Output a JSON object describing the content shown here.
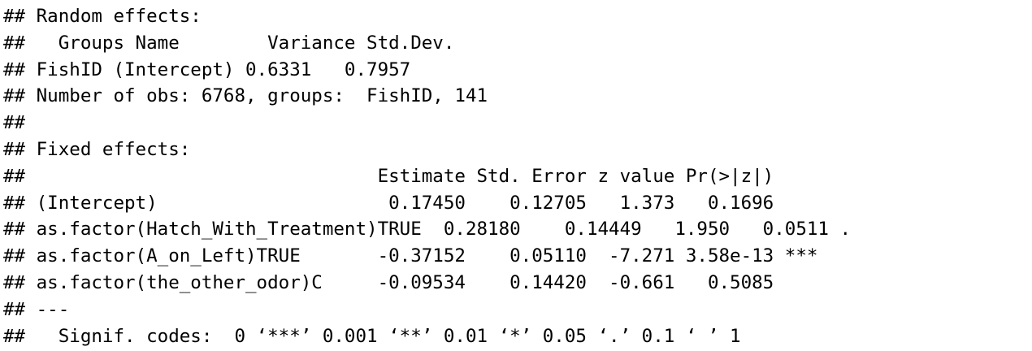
{
  "lines": [
    "## Random effects:",
    "##   Groups Name        Variance Std.Dev.",
    "## FishID (Intercept) 0.6331   0.7957",
    "## Number of obs: 6768, groups:  FishID, 141",
    "##",
    "## Fixed effects:",
    "##                                Estimate Std. Error z value Pr(>|z|)",
    "## (Intercept)                     0.17450    0.12705   1.373   0.1696",
    "## as.factor(Hatch_With_Treatment)TRUE  0.28180    0.14449   1.950   0.0511 .",
    "## as.factor(A_on_Left)TRUE       -0.37152    0.05110  -7.271 3.58e-13 ***",
    "## as.factor(the_other_odor)C     -0.09534    0.14420  -0.661   0.5085",
    "## ---",
    "##   Signif. codes:  0 ‘***’ 0.001 ‘**’ 0.01 ‘*’ 0.05 ‘.’ 0.1 ‘ ’ 1"
  ]
}
